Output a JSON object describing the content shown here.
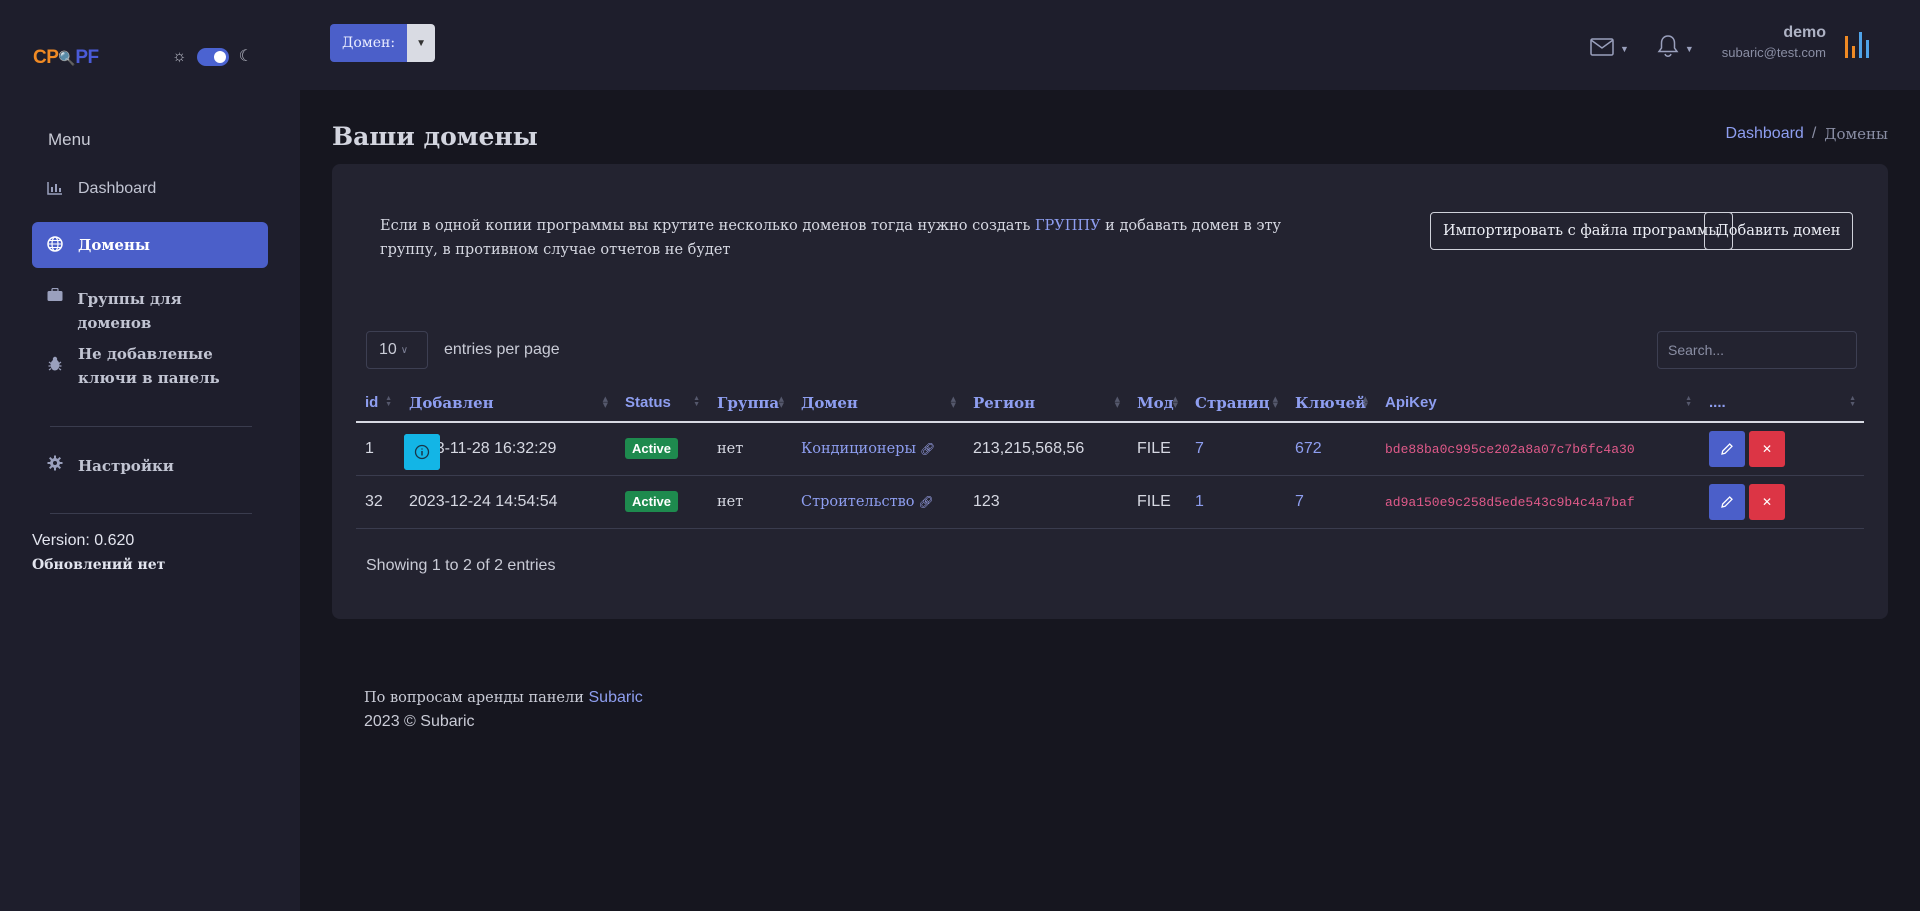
{
  "logo": {
    "part1": "CP",
    "part2": "PF"
  },
  "sidebar": {
    "menu_title": "Menu",
    "items": [
      {
        "label": "Dashboard",
        "icon": "chart-bar-icon"
      },
      {
        "label": "Домены",
        "icon": "globe-icon"
      },
      {
        "label": "Группы для доменов",
        "icon": "briefcase-icon"
      },
      {
        "label": "Не добавленые ключи в панель",
        "icon": "bug-icon"
      },
      {
        "label": "Настройки",
        "icon": "gear-icon"
      }
    ],
    "version": "Version: 0.620",
    "updates": "Обновлений нет"
  },
  "header": {
    "domain_button": "Домен:",
    "user_name": "demo",
    "user_email": "subaric@test.com"
  },
  "page": {
    "title": "Ваши домены",
    "breadcrumb_home": "Dashboard",
    "breadcrumb_sep": "/",
    "breadcrumb_current": "Домены"
  },
  "card": {
    "info_before": "Если в одной копии программы вы крутите несколько доменов тогда нужно создать ",
    "info_link": "ГРУППУ",
    "info_after": " и добавать домен в эту группу, в противном случае отчетов не будет",
    "import_button": "Импортировать с файла программы",
    "add_button": "Добавить домен",
    "per_page_value": "10",
    "per_page_label": "entries per page",
    "search_placeholder": "Search...",
    "showing": "Showing 1 to 2 of 2 entries"
  },
  "table": {
    "headers": [
      "id",
      "Добавлен",
      "Status",
      "Группа",
      "Домен",
      "Регион",
      "Мод",
      "Страниц",
      "Ключей",
      "ApiKey",
      "...."
    ],
    "rows": [
      {
        "id": "1",
        "added": "2023-11-28 16:32:29",
        "status": "Active",
        "group": "нет",
        "domain": "Кондиционеры",
        "region": "213,215,568,56",
        "mod": "FILE",
        "pages": "7",
        "keys": "672",
        "apikey": "bde88ba0c995ce202a8a07c7b6fc4a30"
      },
      {
        "id": "32",
        "added": "2023-12-24 14:54:54",
        "status": "Active",
        "group": "нет",
        "domain": "Строительство",
        "region": "123",
        "mod": "FILE",
        "pages": "1",
        "keys": "7",
        "apikey": "ad9a150e9c258d5ede543c9b4c4a7baf"
      }
    ]
  },
  "footer": {
    "line1": "По вопросам аренды панели ",
    "line1_link": "Subaric",
    "line2": "2023 © Subaric"
  },
  "colors": {
    "accent": "#4b5fc9",
    "link": "#8e9ef0",
    "success": "#1e8a4e",
    "danger": "#dc3545",
    "info": "#13b5e6"
  }
}
